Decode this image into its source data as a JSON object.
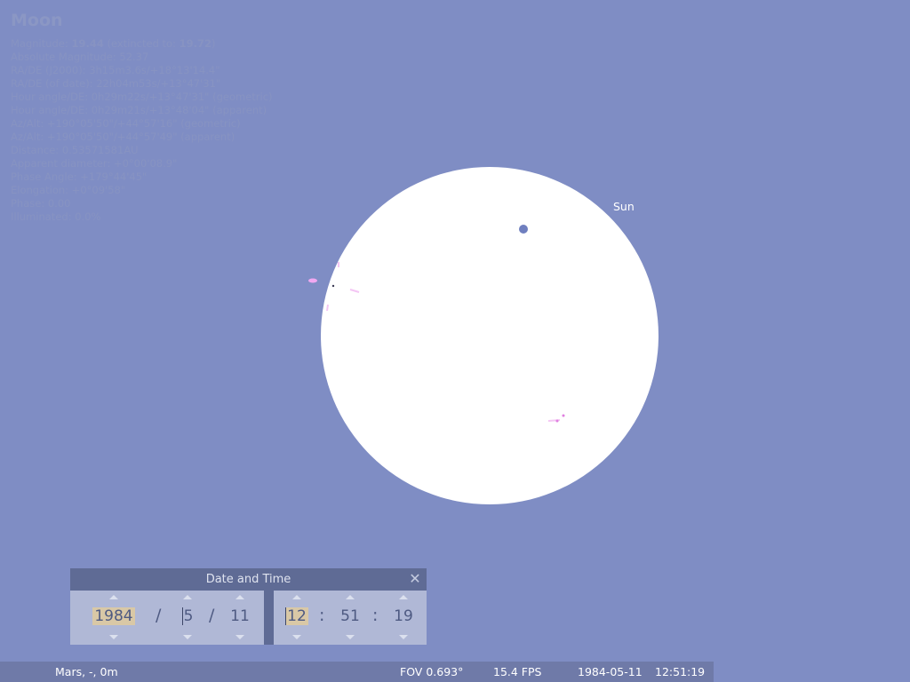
{
  "object": {
    "name": "Moon",
    "magnitude_label": "Magnitude:",
    "magnitude": "19.44",
    "extincted_label": "(extincted to:",
    "extincted": "19.72",
    "lines": [
      "Absolute Magnitude: 52.37",
      "RA/DE (J2000): 3h15m3.6s/+18°13'14.4\"",
      "RA/DE (of date): 22h04m53s/+13°47'31\"",
      "Hour angle/DE: 0h29m22s/+13°47'31\" (geometric)",
      "Hour angle/DE: 0h29m21s/+13°48'04\" (apparent)",
      "Az/Alt: +190°05'50\"/+44°57'16\" (geometric)",
      "Az/Alt: +190°05'50\"/+44°57'49\" (apparent)",
      "Distance: 0.53571581AU",
      "Apparent diameter: +0°00'08.9\"",
      "Phase Angle: +179°44'45\"",
      "Elongation: +0°09'58\"",
      "Phase: 0.00",
      "Illuminated: 0.0%"
    ]
  },
  "sun_label": "Sun",
  "datetime_dialog": {
    "title": "Date and Time",
    "year": "1984",
    "month": "5",
    "day": "11",
    "hour": "12",
    "minute": "51",
    "second": "19",
    "date_sep": "/",
    "time_sep": ":"
  },
  "statusbar": {
    "location": "Mars, -, 0m",
    "fov": "FOV 0.693°",
    "fps": "15.4 FPS",
    "date": "1984-05-11",
    "time": "12:51:19"
  },
  "colors": {
    "sky": "#7f8dc4",
    "sun_disc": "#ffffff",
    "moon_dot": "#6f7fbf",
    "dialog_bg": "#b0b8d6",
    "dialog_titlebar": "#5f6b95",
    "statusbar": "#6f7aa8"
  }
}
